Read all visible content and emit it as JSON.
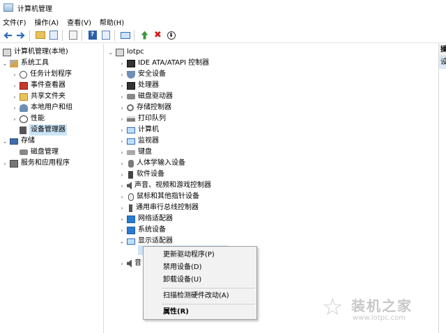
{
  "window": {
    "title": "计算机管理"
  },
  "menu": [
    "文件(F)",
    "操作(A)",
    "查看(V)",
    "帮助(H)"
  ],
  "toolbar": {
    "icons": [
      "back-arrow-icon",
      "forward-arrow-icon",
      "up-folder-icon",
      "show-tree-icon",
      "properties-icon",
      "help-icon",
      "show-pane-icon",
      "monitor-icon",
      "update-driver-icon",
      "uninstall-x-icon",
      "download-icon"
    ],
    "help_glyph": "?"
  },
  "tree": {
    "root": "计算机管理(本地)",
    "system_tools": "系统工具",
    "system_items": [
      "任务计划程序",
      "事件查看器",
      "共享文件夹",
      "本地用户和组",
      "性能",
      "设备管理器"
    ],
    "storage": "存储",
    "storage_items": [
      "磁盘管理"
    ],
    "services": "服务和应用程序"
  },
  "devices": {
    "root": "lotpc",
    "items": [
      "IDE ATA/ATAPI 控制器",
      "安全设备",
      "处理器",
      "磁盘驱动器",
      "存储控制器",
      "打印队列",
      "计算机",
      "监视器",
      "键盘",
      "人体学输入设备",
      "软件设备",
      "声音、视频和游戏控制器",
      "鼠标和其他指针设备",
      "通用串行总线控制器",
      "网络适配器",
      "系统设备",
      "显示适配器"
    ],
    "partial_after": "音"
  },
  "context_menu": {
    "items": [
      "更新驱动程序(P)",
      "禁用设备(D)",
      "卸载设备(U)",
      "扫描检测硬件改动(A)",
      "属性(R)"
    ]
  },
  "right_pane": {
    "header": "操",
    "item": "设"
  },
  "watermark": {
    "title": "装机之家",
    "url": "www.lotpc.com"
  },
  "colors": {
    "selection": "#cce4f7",
    "accent": "#2d6fb8",
    "menu_bg": "#f2f2f2"
  }
}
